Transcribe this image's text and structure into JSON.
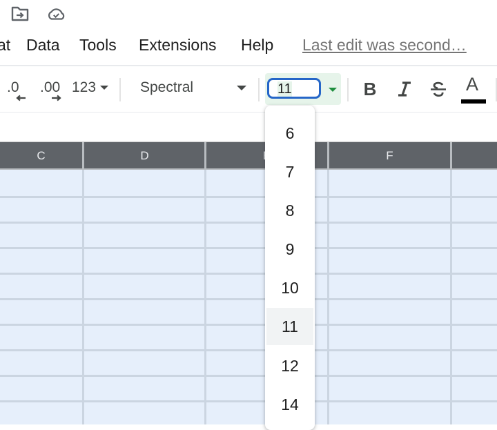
{
  "top_icons": [
    {
      "name": "move-to-folder-icon"
    },
    {
      "name": "cloud-saved-icon"
    }
  ],
  "menubar": {
    "items": [
      {
        "label": "at",
        "name": "menu-format"
      },
      {
        "label": "Data",
        "name": "menu-data"
      },
      {
        "label": "Tools",
        "name": "menu-tools"
      },
      {
        "label": "Extensions",
        "name": "menu-extensions"
      },
      {
        "label": "Help",
        "name": "menu-help"
      }
    ],
    "last_edit": "Last edit was second…"
  },
  "toolbar": {
    "decrease_decimal": ".0",
    "increase_decimal": ".00",
    "number_format": "123",
    "font_family": "Spectral",
    "font_size": "11",
    "bold": "B",
    "italic": "I",
    "strikethrough": "S",
    "text_color": "A",
    "text_color_value": "#000000",
    "accent_color": "#1e8e3e"
  },
  "grid": {
    "columns": [
      "C",
      "D",
      "E",
      "F",
      ""
    ],
    "selection_color": "#e6effb",
    "header_color": "#5f6368"
  },
  "font_size_dropdown": {
    "options": [
      "6",
      "7",
      "8",
      "9",
      "10",
      "11",
      "12",
      "14"
    ],
    "selected": "11"
  }
}
